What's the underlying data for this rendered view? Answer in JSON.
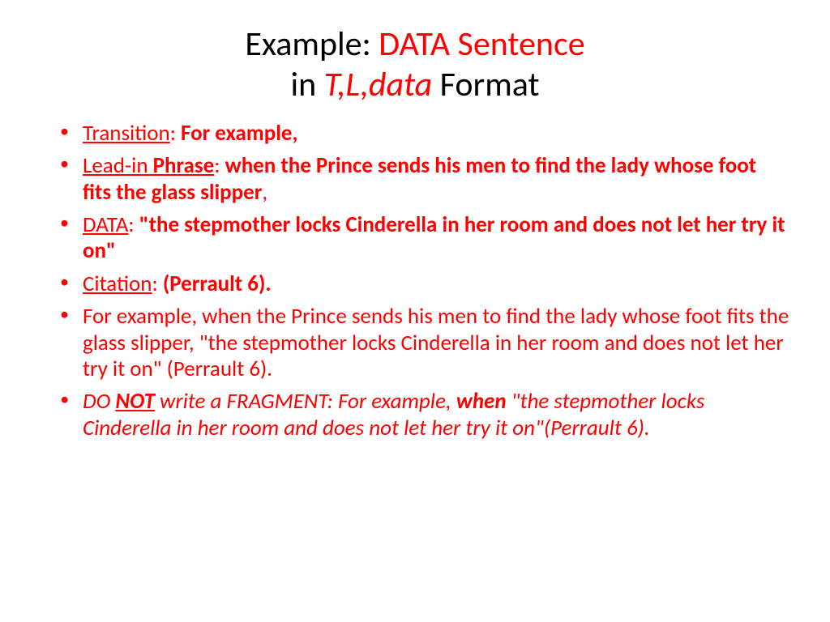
{
  "title": {
    "line1_black": "Example: ",
    "line1_red": "DATA Sentence",
    "line2_black1": "in ",
    "line2_red_italic": "T,L,data",
    "line2_black2": " Format"
  },
  "bullets": {
    "b1": {
      "label": "Transition",
      "colon": ": ",
      "content": "For example,"
    },
    "b2": {
      "label_u": "Lead-in",
      "label_b": " Phrase",
      "colon": ": ",
      "content": "when the Prince sends his men to find the lady whose foot fits the glass slipper",
      "comma": ","
    },
    "b3": {
      "label": "DATA",
      "colon": ": ",
      "content": "\"the stepmother locks Cinderella in her room and does not let her try it on\""
    },
    "b4": {
      "label": "Citation",
      "colon": ": ",
      "content": "(Perrault 6)."
    },
    "b5": {
      "text": "For example, when the Prince sends his men to find the lady whose foot fits the glass slipper, \"the stepmother locks Cinderella in her room and does not let her try it on\" (Perrault 6)."
    },
    "b6": {
      "p1": "DO ",
      "p2": "NOT",
      "p3": " write a FRAGMENT: For example, ",
      "p4": "when",
      "p5": " \"the stepmother locks Cinderella in her room and does not let her try it on\"(Perrault 6)."
    }
  }
}
